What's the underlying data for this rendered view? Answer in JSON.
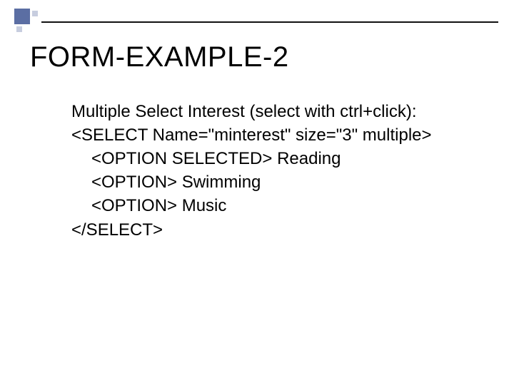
{
  "title": "FORM-EXAMPLE-2",
  "body": {
    "line1": "Multiple Select Interest (select with ctrl+click):",
    "line2": "<SELECT Name=\"minterest\" size=\"3\" multiple>",
    "line3": "<OPTION SELECTED> Reading",
    "line4": "<OPTION> Swimming",
    "line5": "<OPTION> Music",
    "line6": "</SELECT>"
  },
  "colors": {
    "accent": "#5b6ea3",
    "accent_light": "#c7cddf"
  }
}
